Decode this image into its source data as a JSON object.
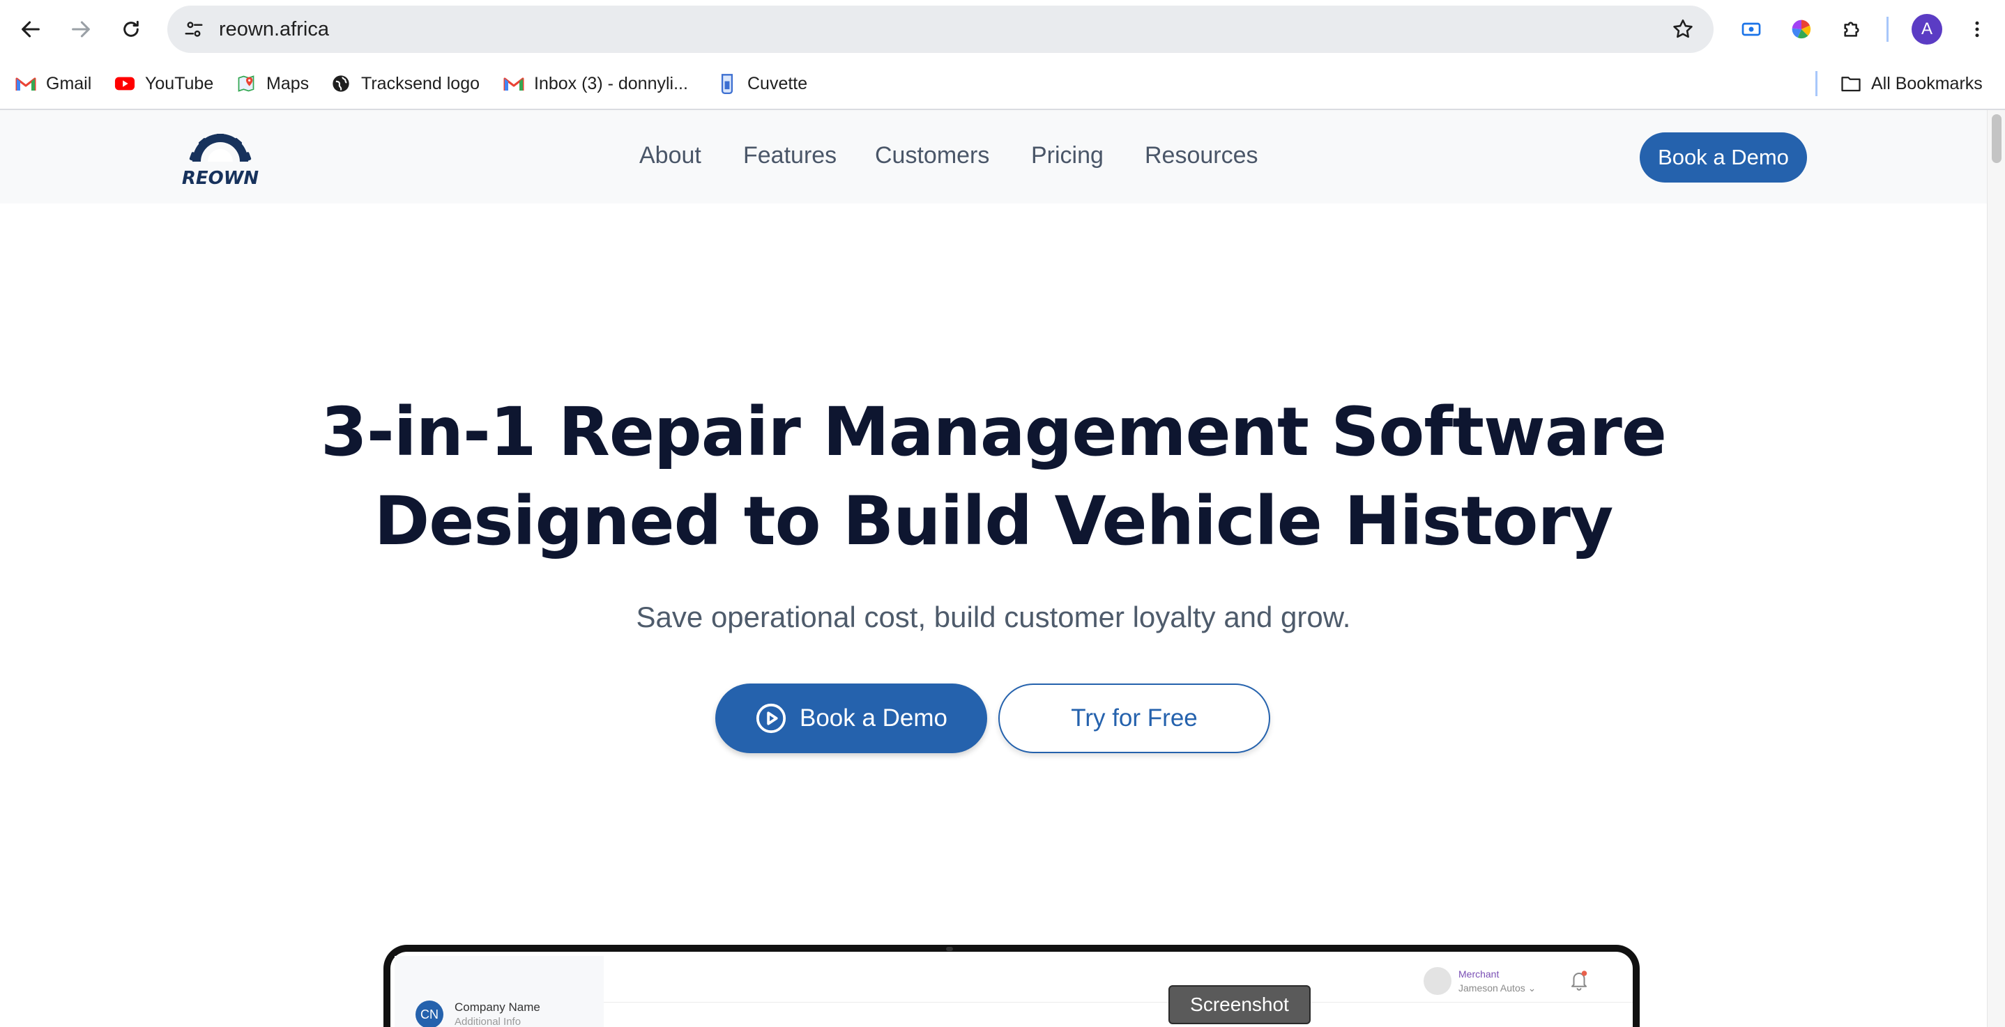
{
  "browser": {
    "url": "reown.africa",
    "profile_initial": "A",
    "bookmarks": [
      {
        "label": "Gmail",
        "icon": "gmail-icon"
      },
      {
        "label": "YouTube",
        "icon": "youtube-icon"
      },
      {
        "label": "Maps",
        "icon": "maps-icon"
      },
      {
        "label": "Tracksend logo",
        "icon": "globe-icon"
      },
      {
        "label": "Inbox (3) - donnyli...",
        "icon": "gmail-icon"
      },
      {
        "label": "Cuvette",
        "icon": "cuvette-icon"
      }
    ],
    "all_bookmarks_label": "All Bookmarks"
  },
  "site": {
    "logo_text": "REOWN",
    "nav": [
      "About",
      "Features",
      "Customers",
      "Pricing",
      "Resources"
    ],
    "header_cta": "Book a Demo"
  },
  "hero": {
    "title_line1": "3-in-1 Repair Management Software",
    "title_line2": "Designed to Build Vehicle History",
    "subtitle": "Save operational cost, build customer loyalty and grow.",
    "primary_cta": "Book a Demo",
    "secondary_cta": "Try for Free"
  },
  "preview": {
    "company_initials": "CN",
    "company_name": "Company Name",
    "company_info": "Additional Info",
    "merchant_label": "Merchant",
    "merchant_name": "Jameson Autos"
  },
  "tooltip": "Screenshot",
  "colors": {
    "brand_blue": "#2562ad",
    "heading": "#0e1630",
    "nav_text": "#4a5668"
  }
}
